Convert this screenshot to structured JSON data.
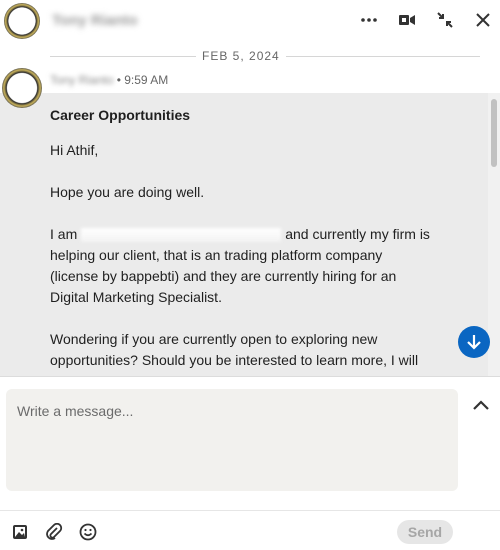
{
  "header": {
    "contact_name": "Tony Rianto"
  },
  "thread": {
    "date_divider": "FEB 5, 2024",
    "message": {
      "sender": "Tony Rianto",
      "time": "• 9:59 AM",
      "subject": "Career Opportunities",
      "greeting": "Hi Athif,",
      "line_1": "Hope you are doing well.",
      "line_2_start": "I am",
      "line_2_rest": "and currently my firm is helping our client, that is an trading platform company (license by bappebti) and they are currently hiring for an Digital Marketing Specialist.",
      "line_3": "Wondering if you are currently open to exploring new opportunities? Should you be interested to learn more, I will have one of my team (Norissa) to share further detail"
    }
  },
  "compose": {
    "placeholder": "Write a message..."
  },
  "footer": {
    "send_label": "Send"
  },
  "colors": {
    "accent": "#0a66c2",
    "thread_background": "#ebebeb",
    "compose_background": "#f2f1ee"
  }
}
